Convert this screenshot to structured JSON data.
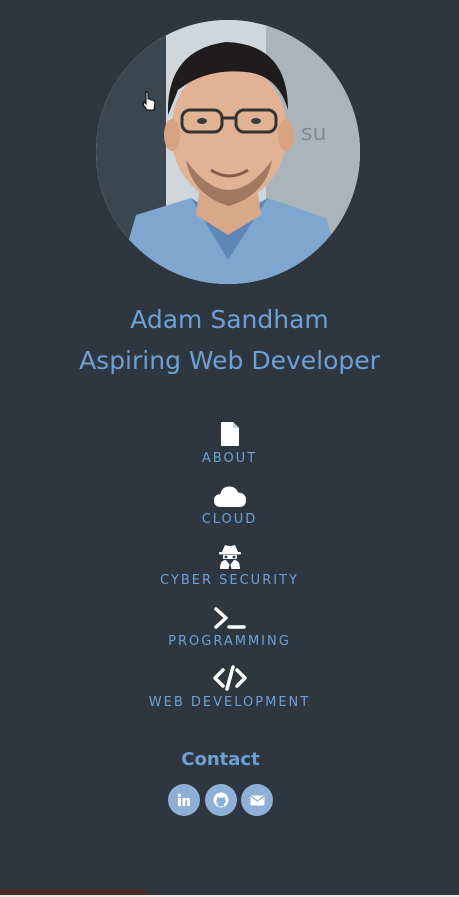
{
  "profile": {
    "name": "Adam Sandham",
    "role": "Aspiring Web Developer"
  },
  "nav": [
    {
      "label": "ABOUT",
      "icon": "file-icon"
    },
    {
      "label": "CLOUD",
      "icon": "cloud-icon"
    },
    {
      "label": "CYBER SECURITY",
      "icon": "spy-icon"
    },
    {
      "label": "PROGRAMMING",
      "icon": "terminal-icon"
    },
    {
      "label": "WEB DEVELOPMENT",
      "icon": "code-icon"
    }
  ],
  "contact": {
    "title": "Contact",
    "links": [
      {
        "icon": "linkedin-icon"
      },
      {
        "icon": "github-icon"
      },
      {
        "icon": "email-icon"
      }
    ]
  },
  "colors": {
    "background": "#2e3640",
    "accent": "#6ea0d4",
    "social_bg": "#8fb0d6",
    "icon": "#ffffff"
  }
}
